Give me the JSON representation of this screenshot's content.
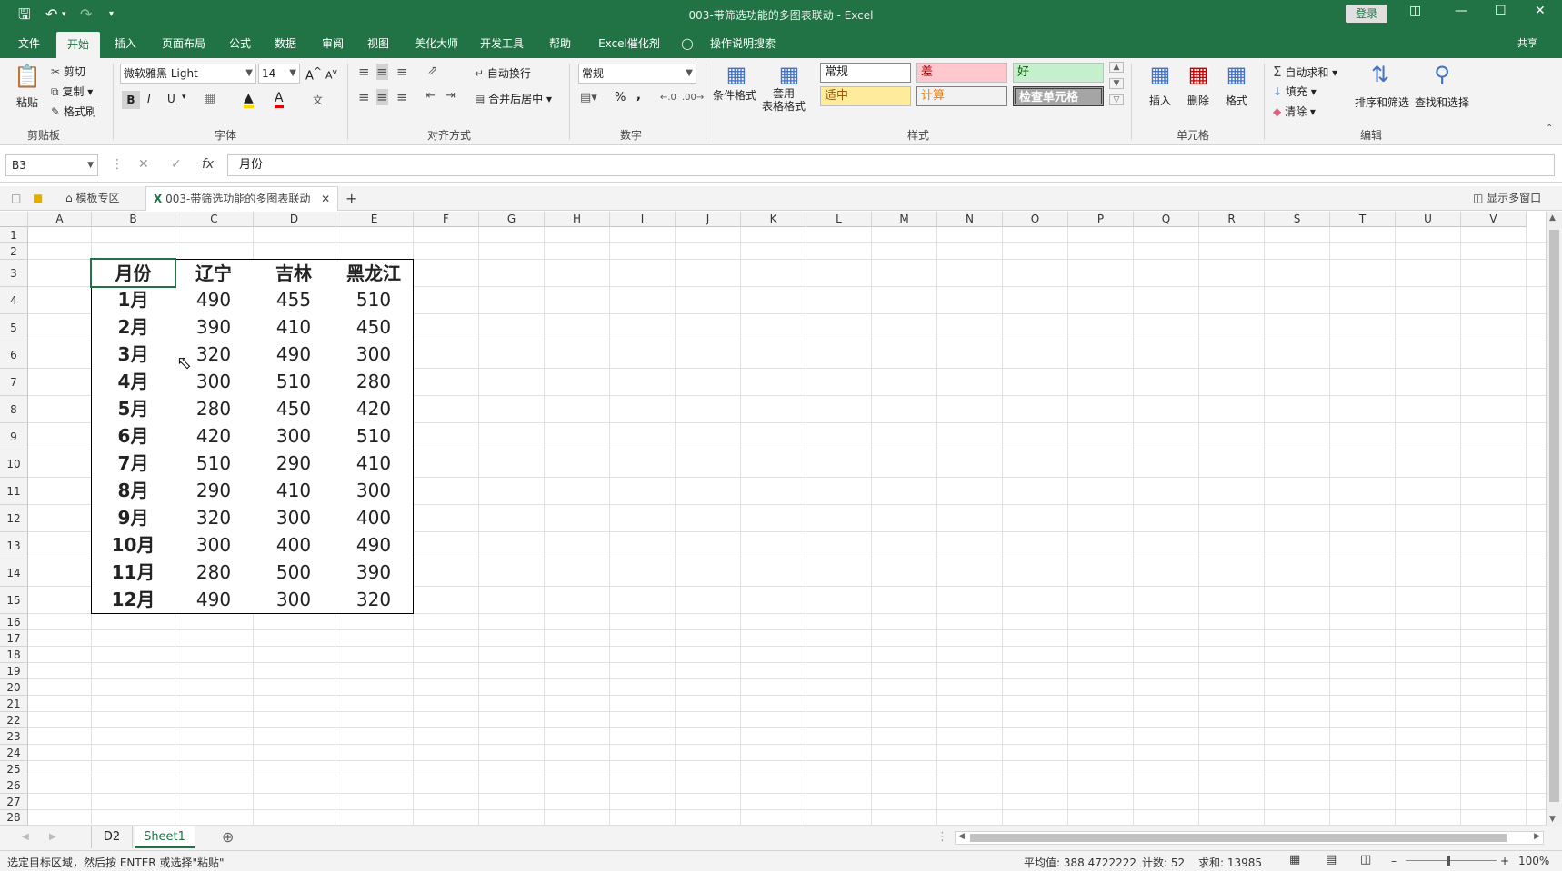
{
  "titlebar": {
    "title": "003-带筛选功能的多图表联动  -  Excel",
    "login": "登录",
    "share": "共享"
  },
  "tabs": [
    "文件",
    "开始",
    "插入",
    "页面布局",
    "公式",
    "数据",
    "审阅",
    "视图",
    "美化大师",
    "开发工具",
    "帮助",
    "Excel催化剂",
    "操作说明搜索"
  ],
  "ribbon": {
    "clipboard": {
      "paste": "粘贴",
      "cut": "剪切",
      "copy": "复制",
      "format_painter": "格式刷",
      "label": "剪贴板"
    },
    "font": {
      "family": "微软雅黑 Light",
      "size": "14",
      "label": "字体",
      "bold": "B",
      "italic": "I",
      "underline": "U"
    },
    "alignment": {
      "wrap": "自动换行",
      "merge": "合并后居中",
      "label": "对齐方式"
    },
    "number": {
      "format": "常规",
      "label": "数字",
      "percent": "%",
      "comma": ","
    },
    "styles": {
      "cond_format": "条件格式",
      "table_format": "套用\n表格格式",
      "normal": "常规",
      "bad": "差",
      "good": "好",
      "neutral": "适中",
      "calc": "计算",
      "check": "检查单元格",
      "label": "样式"
    },
    "cells": {
      "insert": "插入",
      "delete": "删除",
      "format": "格式",
      "label": "单元格"
    },
    "editing": {
      "autosum": "自动求和",
      "fill": "填充",
      "clear": "清除",
      "sort": "排序和筛选",
      "find": "查找和选择",
      "label": "编辑"
    }
  },
  "formula_bar": {
    "name_box": "B3",
    "value": "月份",
    "fx": "fx"
  },
  "doc_tabs": {
    "template": "模板专区",
    "file": "003-带筛选功能的多图表联动",
    "multi_window": "显示多窗口"
  },
  "columns": [
    "A",
    "B",
    "C",
    "D",
    "E",
    "F",
    "G",
    "H",
    "I",
    "J",
    "K",
    "L",
    "M",
    "N",
    "O",
    "P",
    "Q",
    "R",
    "S",
    "T",
    "U",
    "V"
  ],
  "rows": [
    "1",
    "2",
    "3",
    "4",
    "5",
    "6",
    "7",
    "8",
    "9",
    "10",
    "11",
    "12",
    "13",
    "14",
    "15",
    "16",
    "17",
    "18",
    "19",
    "20",
    "21",
    "22",
    "23",
    "24",
    "25",
    "26",
    "27",
    "28"
  ],
  "table": {
    "headers": [
      "月份",
      "辽宁",
      "吉林",
      "黑龙江"
    ],
    "data": [
      [
        "1月",
        "490",
        "455",
        "510"
      ],
      [
        "2月",
        "390",
        "410",
        "450"
      ],
      [
        "3月",
        "320",
        "490",
        "300"
      ],
      [
        "4月",
        "300",
        "510",
        "280"
      ],
      [
        "5月",
        "280",
        "450",
        "420"
      ],
      [
        "6月",
        "420",
        "300",
        "510"
      ],
      [
        "7月",
        "510",
        "290",
        "410"
      ],
      [
        "8月",
        "290",
        "410",
        "300"
      ],
      [
        "9月",
        "320",
        "300",
        "400"
      ],
      [
        "10月",
        "300",
        "400",
        "490"
      ],
      [
        "11月",
        "280",
        "500",
        "390"
      ],
      [
        "12月",
        "490",
        "300",
        "320"
      ]
    ]
  },
  "sheets": [
    "D2",
    "Sheet1"
  ],
  "active_sheet": "Sheet1",
  "status": {
    "message": "选定目标区域，然后按 ENTER 或选择\"粘贴\"",
    "average": "平均值: 388.4722222",
    "count": "计数: 52",
    "sum": "求和: 13985",
    "zoom": "100%"
  },
  "colors": {
    "excel_green": "#217346"
  }
}
